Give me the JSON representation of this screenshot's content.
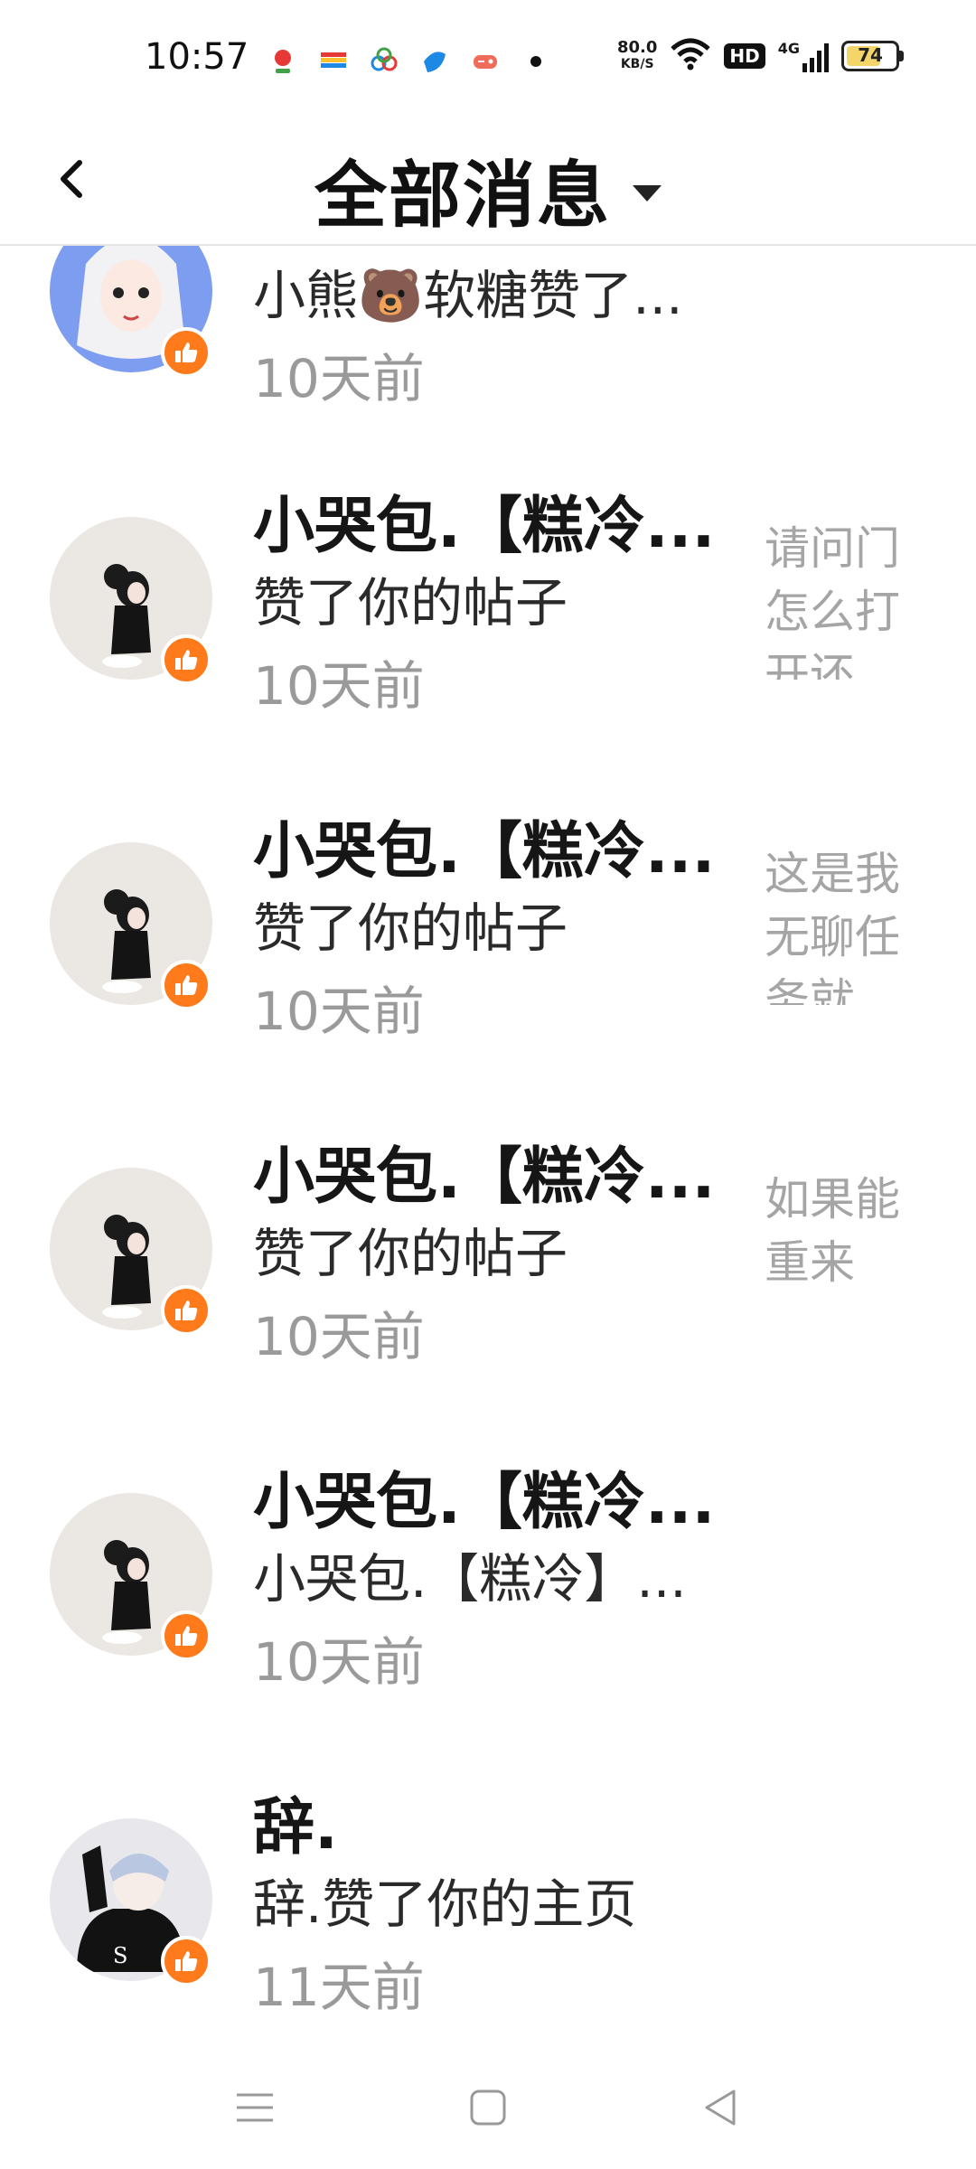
{
  "status_bar": {
    "time": "10:57",
    "net_speed_value": "80.0",
    "net_speed_unit": "KB/S",
    "hd": "HD",
    "network": "4G",
    "battery": "74",
    "battery_fraction": 0.74
  },
  "header": {
    "title": "全部消息"
  },
  "messages": [
    {
      "name": "",
      "action": "小熊🐻软糖赞了...",
      "time": "10天前",
      "preview": ""
    },
    {
      "name": "小哭包.【糕冷...",
      "action": "赞了你的帖子",
      "time": "10天前",
      "preview": "请问门怎么打开还"
    },
    {
      "name": "小哭包.【糕冷...",
      "action": "赞了你的帖子",
      "time": "10天前",
      "preview": "这是我无聊任务就"
    },
    {
      "name": "小哭包.【糕冷...",
      "action": "赞了你的帖子",
      "time": "10天前",
      "preview": "如果能重来"
    },
    {
      "name": "小哭包.【糕冷...",
      "action": "小哭包.【糕冷】...",
      "time": "10天前",
      "preview": ""
    },
    {
      "name": "辞.",
      "action": "辞.赞了你的主页",
      "time": "11天前",
      "preview": ""
    }
  ],
  "colors": {
    "like_badge": "#ff7a1a",
    "time_gray": "#9a9a9a",
    "preview_gray": "#a5a5a5"
  }
}
